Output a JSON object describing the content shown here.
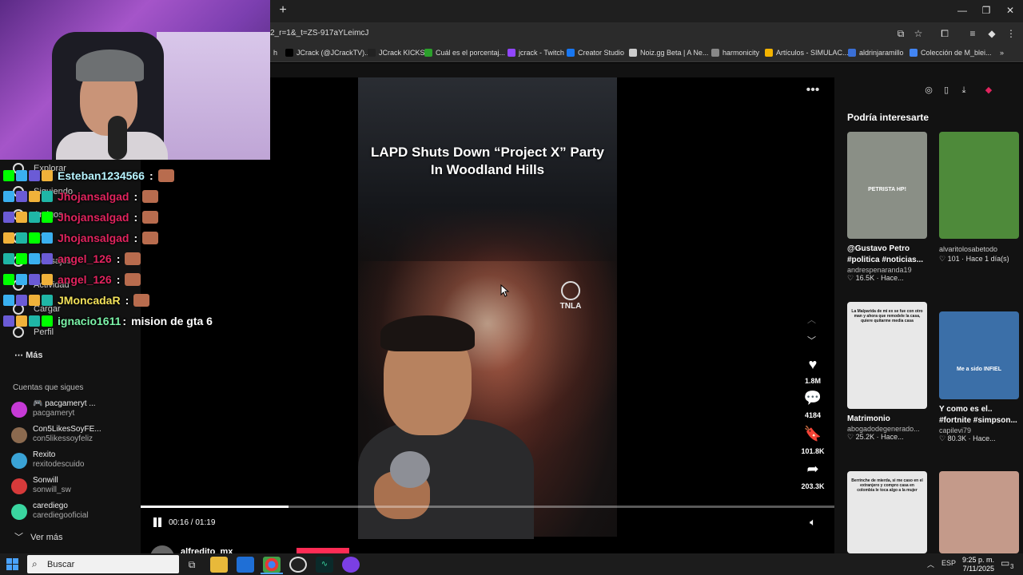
{
  "browser": {
    "new_tab": "+",
    "url": "2_r=1&_t=ZS-917aYLeimcJ",
    "window_controls": {
      "minimize": "—",
      "restore": "❐",
      "close": "✕"
    },
    "bookmarks": [
      {
        "label": "h",
        "icon": "bookmark-icon"
      },
      {
        "label": "JCrack (@JCrackTV)...",
        "icon": "x-icon"
      },
      {
        "label": "JCrack KICKS",
        "icon": "app-icon"
      },
      {
        "label": "Cuál es el porcentaj...",
        "icon": "green-app-icon"
      },
      {
        "label": "jcrack - Twitch",
        "icon": "twitch-icon"
      },
      {
        "label": "Creator Studio",
        "icon": "facebook-icon"
      },
      {
        "label": "Noiz.gg Beta | A Ne...",
        "icon": "noiz-icon"
      },
      {
        "label": "harmonicity",
        "icon": "folder-icon"
      },
      {
        "label": "Artículos - SIMULAC...",
        "icon": "drive-icon"
      },
      {
        "label": "aldrinjaramillo",
        "icon": "app-icon"
      },
      {
        "label": "Colección de M_blei...",
        "icon": "doc-icon"
      }
    ],
    "bookmarks_overflow": "»"
  },
  "chat": {
    "lines": [
      {
        "user": "Esteban1234566",
        "color": "#b7f4ff",
        "message": ""
      },
      {
        "user": "Jhojansalgad",
        "color": "#e0245e",
        "message": ""
      },
      {
        "user": "Jhojansalgad",
        "color": "#e0245e",
        "message": ""
      },
      {
        "user": "Jhojansalgad",
        "color": "#e0245e",
        "message": ""
      },
      {
        "user": "angel_126",
        "color": "#e0245e",
        "message": ""
      },
      {
        "user": "angel_126",
        "color": "#e0245e",
        "message": ""
      },
      {
        "user": "JMoncadaR",
        "color": "#f3e25a",
        "message": ""
      },
      {
        "user": "ignacio1611",
        "color": "#7cf4a9",
        "message": "mision de gta 6"
      }
    ]
  },
  "sidebar": {
    "nav": [
      {
        "label": "Explorar",
        "icon": "compass-icon"
      },
      {
        "label": "Siguiendo",
        "icon": "following-icon"
      },
      {
        "label": "Amigos",
        "icon": "friends-icon"
      },
      {
        "label": "LIVE",
        "icon": "live-icon"
      },
      {
        "label": "Mensajes",
        "icon": "messages-icon"
      },
      {
        "label": "Actividad",
        "icon": "activity-icon"
      },
      {
        "label": "Cargar",
        "icon": "upload-icon"
      },
      {
        "label": "Perfil",
        "icon": "profile-icon"
      }
    ],
    "more": "Más",
    "following_title": "Cuentas que sigues",
    "accounts": [
      {
        "name": "🎮 pacgameryt ...",
        "handle": "pacgameryt",
        "color": "#c63ad6"
      },
      {
        "name": "Con5LikesSoyFE...",
        "handle": "con5likessoyfeliz",
        "color": "#8b6a4f"
      },
      {
        "name": "Rexito",
        "handle": "rexitodescuido",
        "color": "#3aa3d6"
      },
      {
        "name": "Sonwill",
        "handle": "sonwill_sw",
        "color": "#d63a3a"
      },
      {
        "name": "carediego",
        "handle": "carediegooficial",
        "color": "#3ad6a0"
      }
    ],
    "see_more": "Ver más"
  },
  "video": {
    "title": "LAPD Shuts Down “Project X” Party In Woodland Hills",
    "watermark": "TNLA",
    "author": "alfredito_mx",
    "time": "00:16 / 01:19",
    "progress": 0.213,
    "menu": "•••"
  },
  "actions": [
    {
      "icon": "heart-icon",
      "glyph": "♥",
      "count": "1.8M"
    },
    {
      "icon": "comment-icon",
      "glyph": "💬",
      "count": "4184"
    },
    {
      "icon": "bookmark-icon",
      "glyph": "🔖",
      "count": "101.8K"
    },
    {
      "icon": "share-icon",
      "glyph": "➦",
      "count": "203.3K"
    }
  ],
  "recommendations": {
    "title": "Podría interesarte",
    "items": [
      {
        "title": "@Gustavo Petro #politica #noticias...",
        "author": "andrespenaranda19",
        "meta": "♡ 16.5K · Hace...",
        "thumb_text": "PETRISTA HP!",
        "thumb_color": "#8a8f86"
      },
      {
        "title": "alvaritolosabetodo",
        "author": "",
        "meta": "♡ 101 · Hace 1 día(s)",
        "thumb_text": "",
        "thumb_color": "#4e8a3a"
      },
      {
        "title": "Matrimonio",
        "author": "abogadodegenerado...",
        "meta": "♡ 25.2K · Hace...",
        "thumb_text": "La Malparida de mi ex se fue con otro man y ahora que remodele la casa, quiere quitarme media casa",
        "thumb_color": "#e8e8e8"
      },
      {
        "title": "Y como es el.. #fortnite #simpson...",
        "author": "capilevi79",
        "meta": "♡ 80.3K · Hace...",
        "thumb_text": "Me a sido INFIEL",
        "thumb_color": "#3b6fa8"
      },
      {
        "title": "",
        "author": "",
        "meta": "",
        "thumb_text": "Berrinche de mierda, si me caso en el extranjero y compro casa en colombia le toca algo a la mujer",
        "thumb_color": "#e8e8e8"
      },
      {
        "title": "",
        "author": "",
        "meta": "",
        "thumb_text": "",
        "thumb_color": "#c49a8a"
      }
    ]
  },
  "taskbar": {
    "search_placeholder": "Buscar",
    "language": "ESP",
    "time": "9:25 p. m.",
    "date": "7/11/2025",
    "notifications": "3"
  }
}
